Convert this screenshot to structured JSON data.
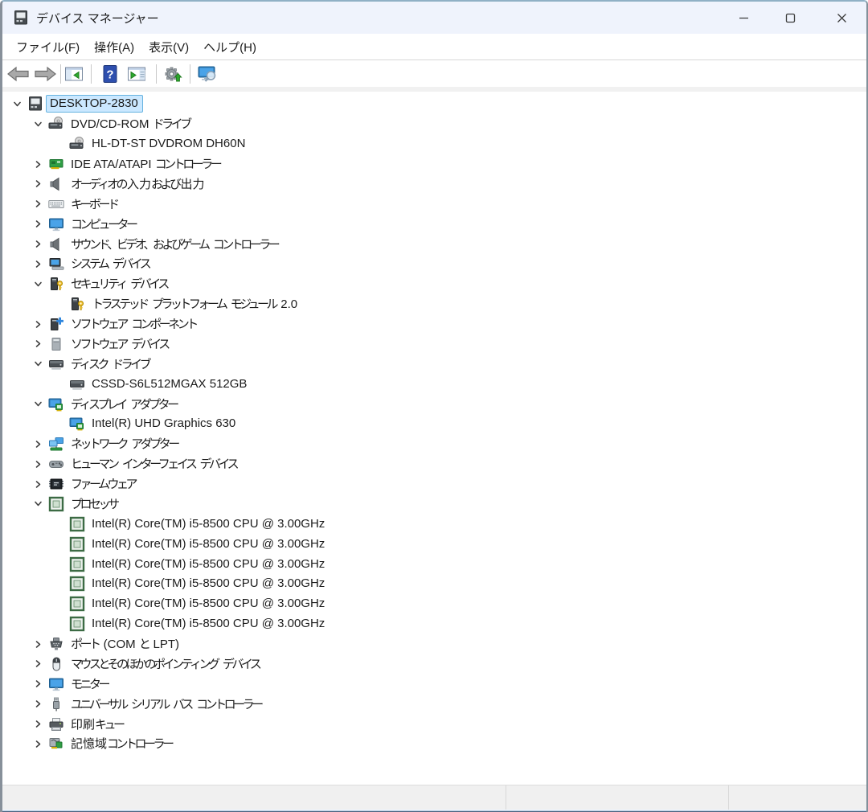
{
  "window": {
    "title": "デバイス マネージャー"
  },
  "menubar": {
    "items": [
      {
        "key": "file",
        "label": "ファイル(F)"
      },
      {
        "key": "action",
        "label": "操作(A)"
      },
      {
        "key": "view",
        "label": "表示(V)"
      },
      {
        "key": "help",
        "label": "ヘルプ(H)"
      }
    ]
  },
  "toolbar": {
    "items": [
      {
        "type": "button",
        "name": "back-button",
        "icon": "back"
      },
      {
        "type": "button",
        "name": "forward-button",
        "icon": "forward"
      },
      {
        "type": "divider"
      },
      {
        "type": "button",
        "name": "show-console-tree-button",
        "icon": "console"
      },
      {
        "type": "divider"
      },
      {
        "type": "button",
        "name": "help-button",
        "icon": "help"
      },
      {
        "type": "button",
        "name": "show-action-pane-button",
        "icon": "action"
      },
      {
        "type": "divider"
      },
      {
        "type": "button",
        "name": "update-driver-button",
        "icon": "gear"
      },
      {
        "type": "divider"
      },
      {
        "type": "button",
        "name": "scan-hardware-changes-button",
        "icon": "scan"
      }
    ]
  },
  "tree": {
    "items": [
      {
        "level": 0,
        "expander": "down",
        "icon": "computer",
        "label": "DESKTOP-2830",
        "selected": true
      },
      {
        "level": 1,
        "expander": "down",
        "icon": "dvd",
        "label": "DVD/CD-ROM ドライブ"
      },
      {
        "level": 2,
        "expander": "none",
        "icon": "dvd",
        "label": "HL-DT-ST DVDROM DH60N"
      },
      {
        "level": 1,
        "expander": "right",
        "icon": "ide",
        "label": "IDE ATA/ATAPI コントローラー"
      },
      {
        "level": 1,
        "expander": "right",
        "icon": "audio",
        "label": "オーディオの入力および出力"
      },
      {
        "level": 1,
        "expander": "right",
        "icon": "keyboard",
        "label": "キーボード"
      },
      {
        "level": 1,
        "expander": "right",
        "icon": "monitor",
        "label": "コンピューター"
      },
      {
        "level": 1,
        "expander": "right",
        "icon": "audio",
        "label": "サウンド、ビデオ、およびゲーム コントローラー"
      },
      {
        "level": 1,
        "expander": "right",
        "icon": "system",
        "label": "システム デバイス"
      },
      {
        "level": 1,
        "expander": "down",
        "icon": "security",
        "label": "セキュリティ デバイス"
      },
      {
        "level": 2,
        "expander": "none",
        "icon": "security",
        "label": "トラステッド プラットフォーム モジュール 2.0"
      },
      {
        "level": 1,
        "expander": "right",
        "icon": "softcomp",
        "label": "ソフトウェア コンポーネント"
      },
      {
        "level": 1,
        "expander": "right",
        "icon": "softdev",
        "label": "ソフトウェア デバイス"
      },
      {
        "level": 1,
        "expander": "down",
        "icon": "disk",
        "label": "ディスク ドライブ"
      },
      {
        "level": 2,
        "expander": "none",
        "icon": "disk",
        "label": "CSSD-S6L512MGAX 512GB"
      },
      {
        "level": 1,
        "expander": "down",
        "icon": "display",
        "label": "ディスプレイ アダプター"
      },
      {
        "level": 2,
        "expander": "none",
        "icon": "display",
        "label": "Intel(R) UHD Graphics 630"
      },
      {
        "level": 1,
        "expander": "right",
        "icon": "network",
        "label": "ネットワーク アダプター"
      },
      {
        "level": 1,
        "expander": "right",
        "icon": "hid",
        "label": "ヒューマン インターフェイス デバイス"
      },
      {
        "level": 1,
        "expander": "right",
        "icon": "firmware",
        "label": "ファームウェア"
      },
      {
        "level": 1,
        "expander": "down",
        "icon": "cpu",
        "label": "プロセッサ"
      },
      {
        "level": 2,
        "expander": "none",
        "icon": "cpu",
        "label": "Intel(R) Core(TM) i5-8500 CPU @ 3.00GHz"
      },
      {
        "level": 2,
        "expander": "none",
        "icon": "cpu",
        "label": "Intel(R) Core(TM) i5-8500 CPU @ 3.00GHz"
      },
      {
        "level": 2,
        "expander": "none",
        "icon": "cpu",
        "label": "Intel(R) Core(TM) i5-8500 CPU @ 3.00GHz"
      },
      {
        "level": 2,
        "expander": "none",
        "icon": "cpu",
        "label": "Intel(R) Core(TM) i5-8500 CPU @ 3.00GHz"
      },
      {
        "level": 2,
        "expander": "none",
        "icon": "cpu",
        "label": "Intel(R) Core(TM) i5-8500 CPU @ 3.00GHz"
      },
      {
        "level": 2,
        "expander": "none",
        "icon": "cpu",
        "label": "Intel(R) Core(TM) i5-8500 CPU @ 3.00GHz"
      },
      {
        "level": 1,
        "expander": "right",
        "icon": "port",
        "label": "ポート (COM と LPT)"
      },
      {
        "level": 1,
        "expander": "right",
        "icon": "mouse",
        "label": "マウスとそのほかのポインティング デバイス"
      },
      {
        "level": 1,
        "expander": "right",
        "icon": "monitor",
        "label": "モニター"
      },
      {
        "level": 1,
        "expander": "right",
        "icon": "usb",
        "label": "ユニバーサル シリアル バス コントローラー"
      },
      {
        "level": 1,
        "expander": "right",
        "icon": "printer",
        "label": "印刷キュー"
      },
      {
        "level": 1,
        "expander": "right",
        "icon": "storage",
        "label": "記憶域コントローラー"
      }
    ]
  },
  "statusbar": {
    "sections": [
      {
        "text": ""
      },
      {
        "text": ""
      },
      {
        "text": ""
      }
    ]
  }
}
